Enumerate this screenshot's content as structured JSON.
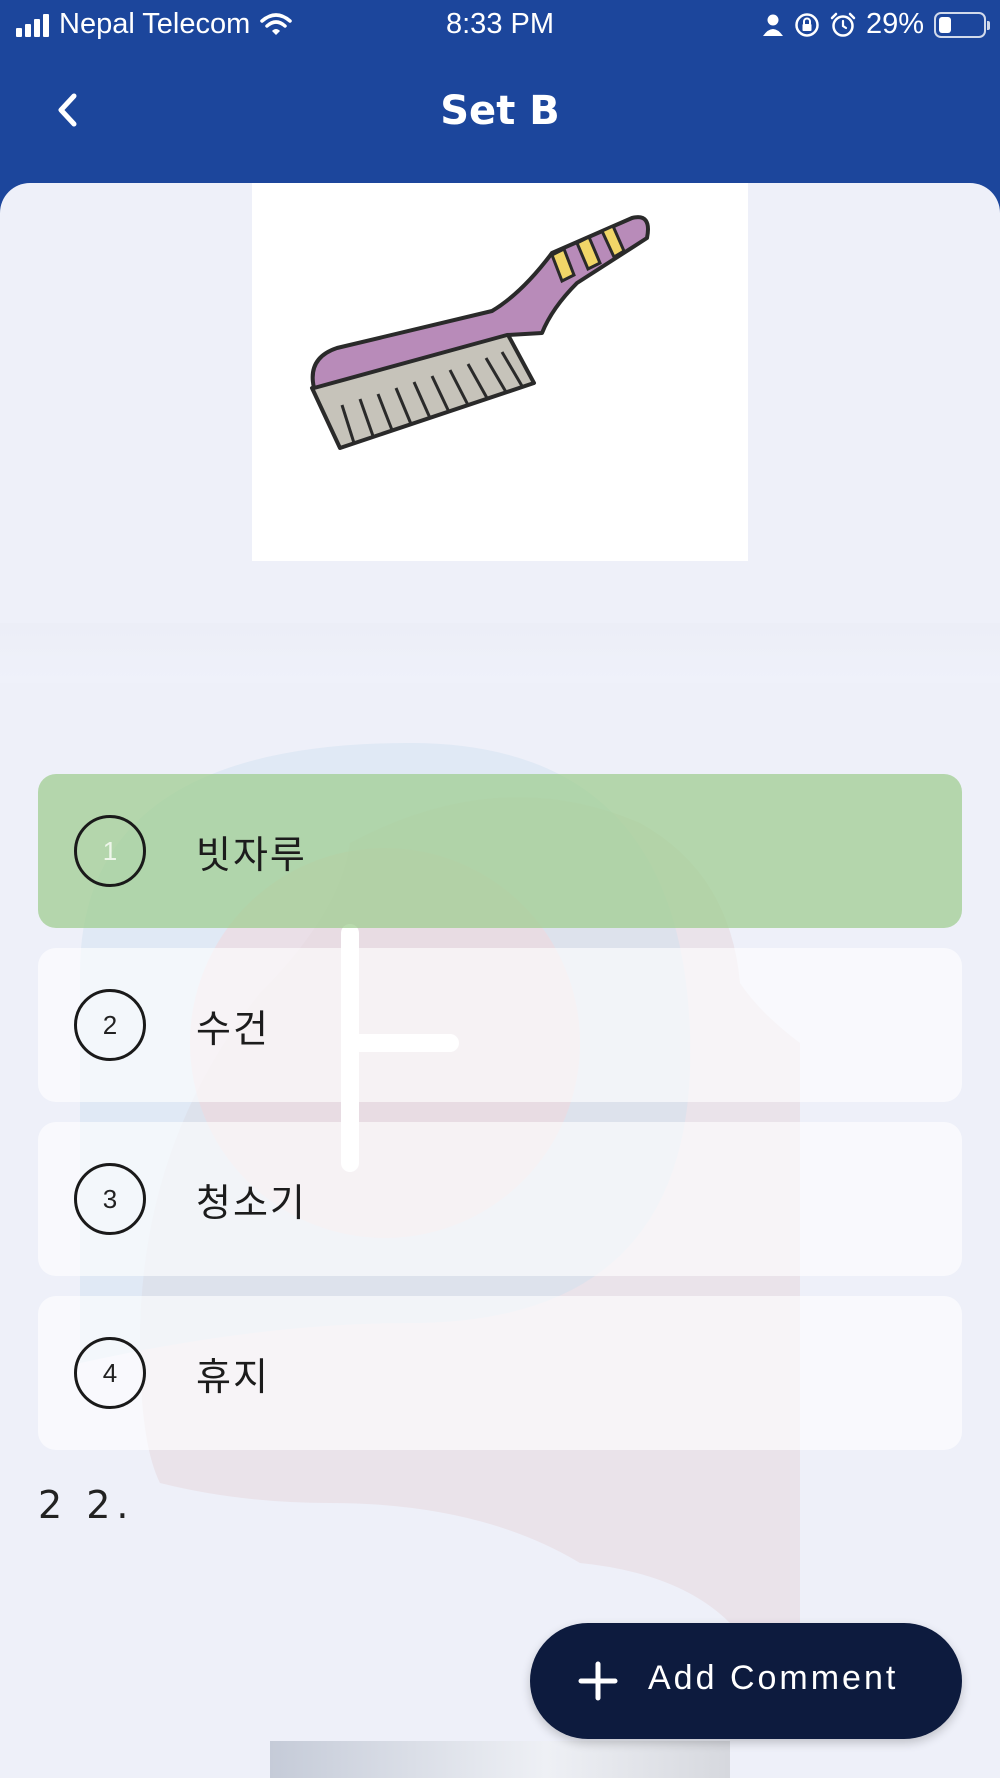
{
  "status_bar": {
    "carrier": "Nepal Telecom",
    "time": "8:33 PM",
    "battery_percent": "29%",
    "battery_level": 0.29,
    "icons": [
      "signal-icon",
      "wifi-icon",
      "person-icon",
      "rotation-lock-icon",
      "alarm-icon",
      "battery-icon"
    ]
  },
  "nav": {
    "title": "Set B",
    "back_icon": "chevron-left-icon"
  },
  "question": {
    "image_subject": "brush-illustration",
    "options": [
      {
        "number": "1",
        "text": "빗자루",
        "state": "correct"
      },
      {
        "number": "2",
        "text": "수건",
        "state": "default"
      },
      {
        "number": "3",
        "text": "청소기",
        "state": "default"
      },
      {
        "number": "4",
        "text": "휴지",
        "state": "default"
      }
    ],
    "next_label": "2 2."
  },
  "fab": {
    "label": "Add Comment",
    "icon": "plus-icon"
  },
  "colors": {
    "header": "#1c469c",
    "background": "#eef0f9",
    "correct": "#b5d7ae",
    "fab": "#0d1b3e"
  }
}
